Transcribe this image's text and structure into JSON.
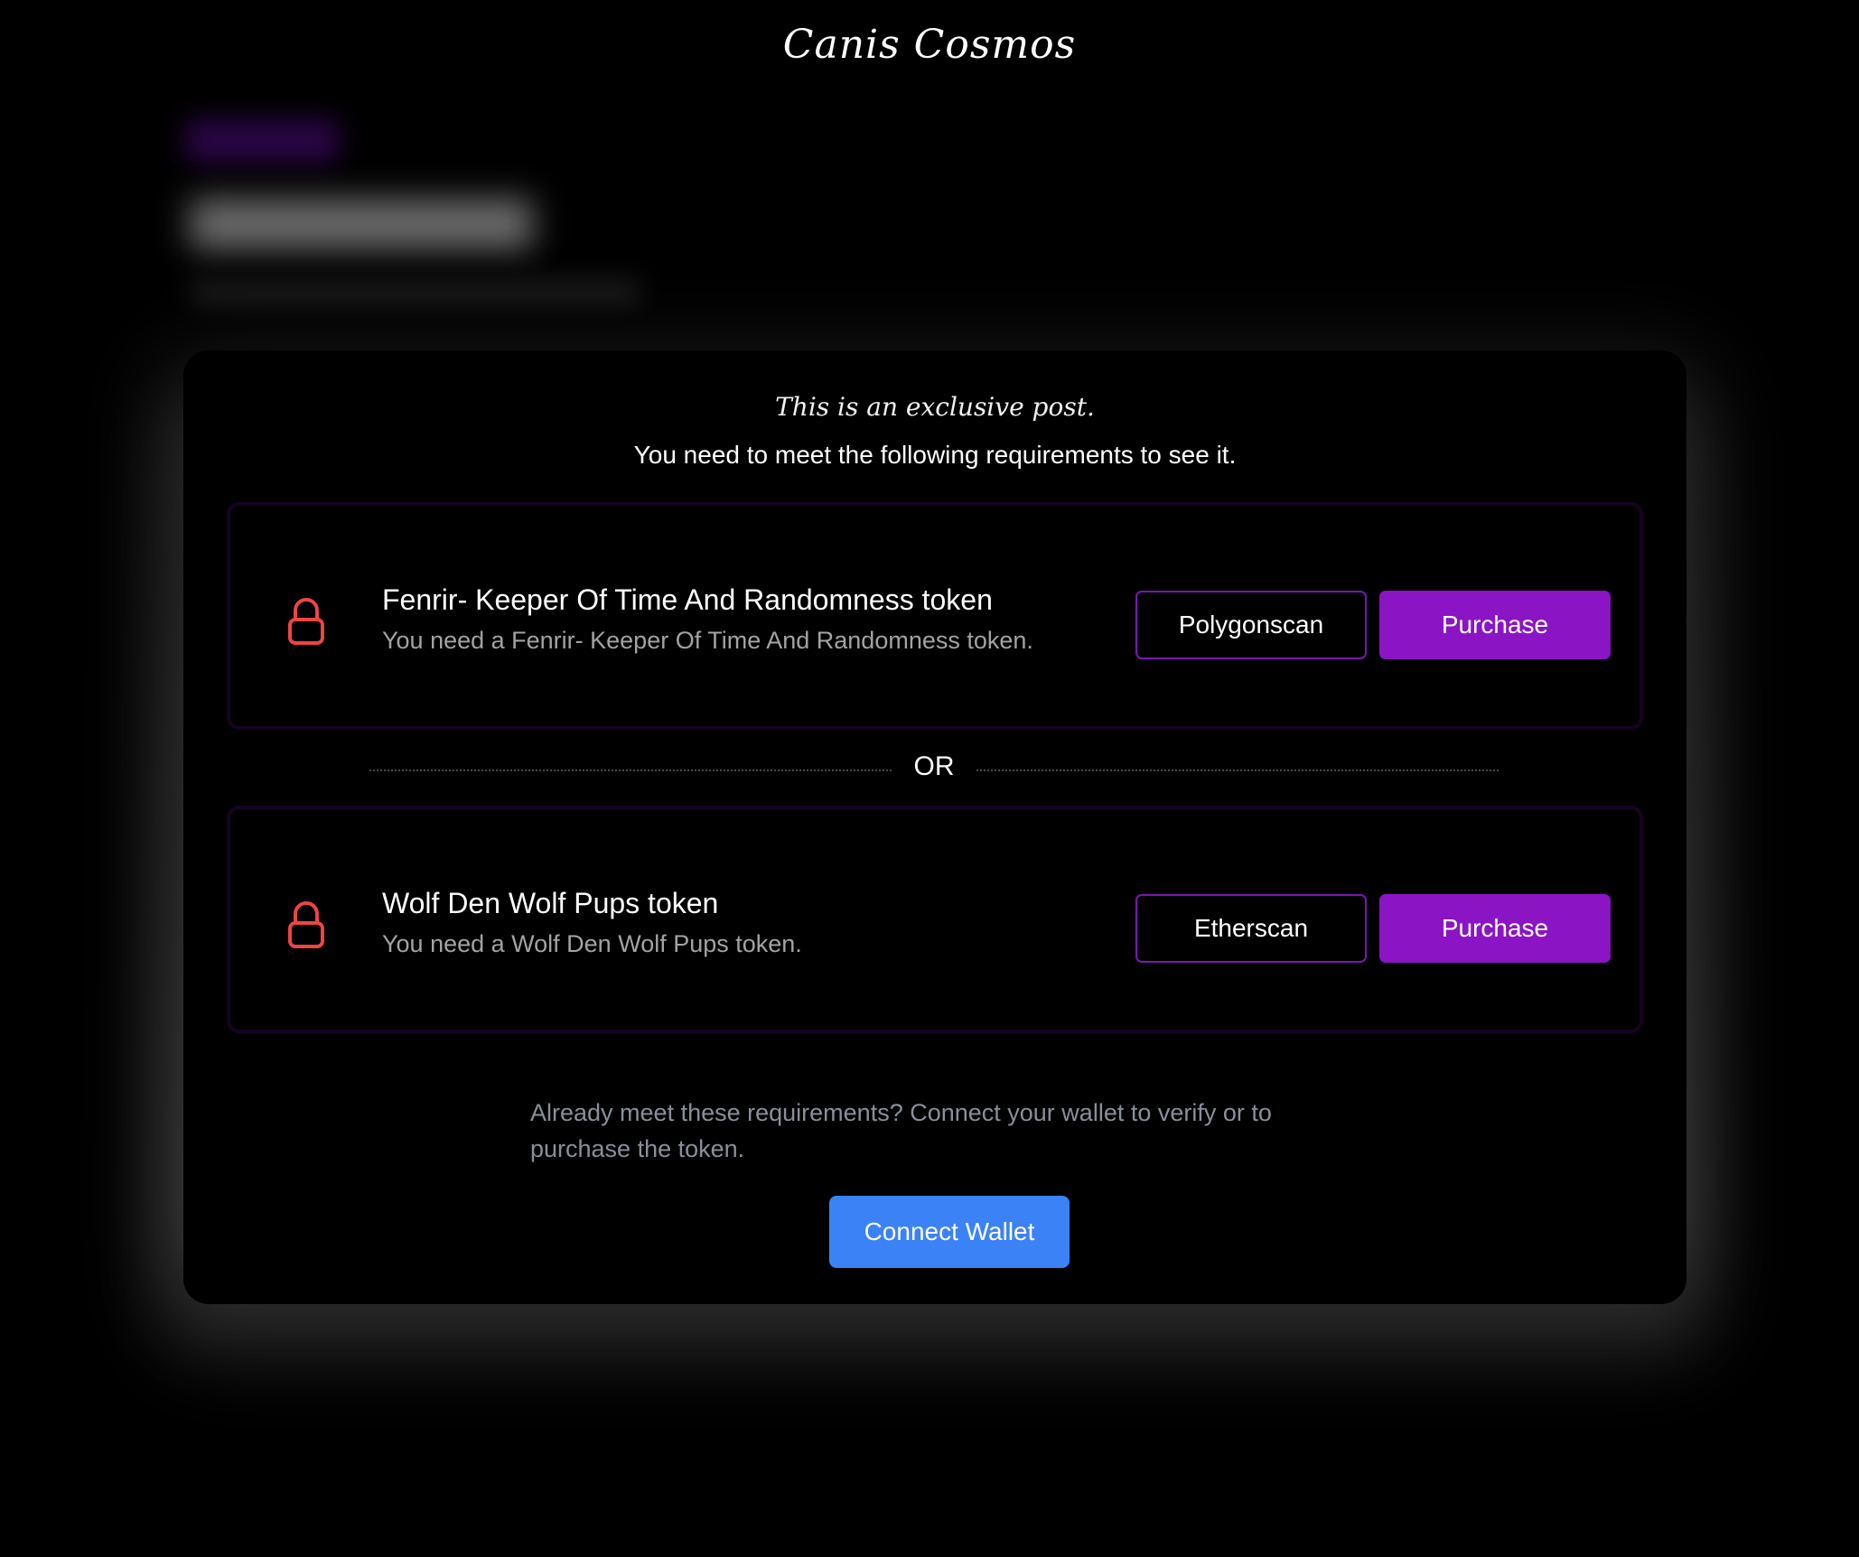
{
  "header": {
    "site_title": "Canis Cosmos"
  },
  "gate": {
    "intro": "This is an exclusive post.",
    "description": "You need to meet the following requirements to see it.",
    "or_label": "OR",
    "requirements": [
      {
        "title": "Fenrir- Keeper Of Time And Randomness token",
        "subtitle": "You need a Fenrir- Keeper Of Time And Randomness token.",
        "explorer_label": "Polygonscan",
        "purchase_label": "Purchase",
        "icon": "lock-icon"
      },
      {
        "title": "Wolf Den Wolf Pups token",
        "subtitle": "You need a Wolf Den Wolf Pups token.",
        "explorer_label": "Etherscan",
        "purchase_label": "Purchase",
        "icon": "lock-icon"
      }
    ],
    "wallet_note": "Already meet these requirements? Connect your wallet to verify or to purchase the token.",
    "connect_label": "Connect Wallet"
  },
  "colors": {
    "background": "#000000",
    "accent_purple": "#8b14c4",
    "connect_blue": "#3b82f6",
    "lock_red": "#ef4444",
    "muted_text": "#8a8f9c"
  }
}
